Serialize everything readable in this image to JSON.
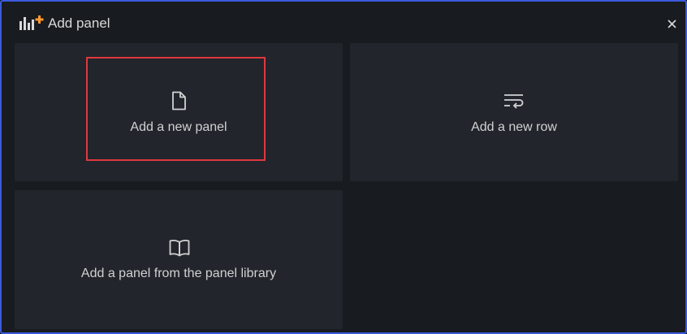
{
  "dialog": {
    "title": "Add panel",
    "close_symbol": "×"
  },
  "options": [
    {
      "label": "Add a new panel",
      "icon": "file-icon"
    },
    {
      "label": "Add a new row",
      "icon": "row-wrap-icon"
    },
    {
      "label": "Add a panel from the panel library",
      "icon": "book-icon"
    }
  ],
  "colors": {
    "background": "#181b1f",
    "tile": "#22252b",
    "text": "#d0d1d3",
    "accent_orange": "#ff9830",
    "highlight_red": "#e0383f",
    "border_blue": "#3b5bdb"
  }
}
